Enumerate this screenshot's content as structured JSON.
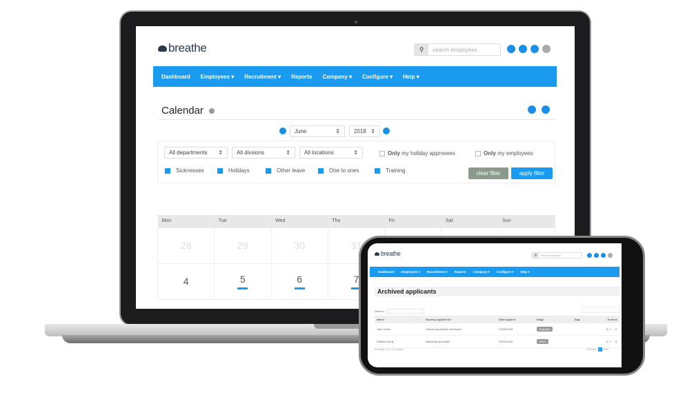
{
  "laptop": {
    "brand": "breathe",
    "search_placeholder": "search employees",
    "nav": [
      "Dashboard",
      "Employees ▾",
      "Recruitment ▾",
      "Reports",
      "Company ▾",
      "Configure ▾",
      "Help ▾"
    ],
    "page_title": "Calendar",
    "month": "June",
    "year": "2018",
    "filters": {
      "department": "All departments",
      "division": "All divsions",
      "location": "All locations"
    },
    "only_holiday": {
      "bold": "Only",
      "rest": " my holiday approvees"
    },
    "only_employees": {
      "bold": "Only",
      "rest": " my employees"
    },
    "types": [
      "Sicknesses",
      "Holidays",
      "Other leave",
      "One to ones",
      "Training"
    ],
    "clear_filter": "clear filter",
    "apply_filter": "apply filter",
    "days": [
      "Mon",
      "Tue",
      "Wed",
      "Thu",
      "Fri",
      "Sat",
      "Sun"
    ],
    "week1": [
      "28",
      "29",
      "30",
      "31",
      "",
      "",
      ""
    ],
    "week2": [
      "4",
      "5",
      "6",
      "7",
      "",
      "",
      ""
    ],
    "accent": "#1a9bf0"
  },
  "phone": {
    "brand": "breathe",
    "search_placeholder": "Search employees",
    "nav": [
      "Dashboard",
      "Employees ▾",
      "Recruitment ▾",
      "Reports",
      "Company ▾",
      "Configure ▾",
      "Help ▾"
    ],
    "page_title": "Archived applicants",
    "search_label": "Search:",
    "columns": [
      "Name",
      "↕",
      "Vacancy applied for",
      "Date applied",
      "Stage",
      "Tags",
      "Actions"
    ],
    "rows": [
      {
        "name": "Jack Jones",
        "vacancy": "Trainee application developer",
        "date": "20/06/2018",
        "stage": "Rejected"
      },
      {
        "name": "William Hardy",
        "vacancy": "Marketing specialist",
        "date": "05/04/2018",
        "stage": "Hired"
      }
    ],
    "footer": "Showing 1 to 2 of 2 entries",
    "prev": "Previous",
    "page": "1",
    "next": "Next"
  }
}
